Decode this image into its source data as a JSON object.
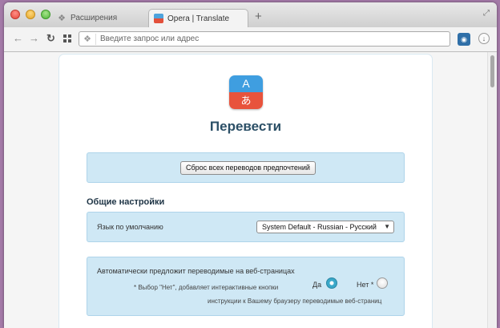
{
  "tabs": [
    {
      "label": "Расширения",
      "icon": "puzzle-icon",
      "active": false
    },
    {
      "label": "Opera | Translate",
      "icon": "opera-translate-icon",
      "active": true
    }
  ],
  "toolbar": {
    "address_placeholder": "Введите запрос или адрес"
  },
  "page": {
    "logo_top": "A",
    "logo_bottom": "あ",
    "title": "Перевести",
    "reset_button": "Сброс всех переводов предпочтений",
    "general_settings_title": "Общие настройки",
    "default_language_label": "Язык по умолчанию",
    "default_language_value": "System Default - Russian - Русский",
    "auto_translate_label": "Автоматически предложит переводимые на веб-страницах",
    "note_line1": "* Выбор \"Нет\", добавляет интерактивные кнопки",
    "note_line2": "инструкции к Вашему браузеру переводимые веб-страниц",
    "yes_label": "Да",
    "no_label": "Нет *",
    "selected_option": "Да"
  },
  "colors": {
    "panel_bg": "#cfe8f5",
    "title_color": "#2b4f66",
    "radio_selected": "#3aa8c9"
  }
}
